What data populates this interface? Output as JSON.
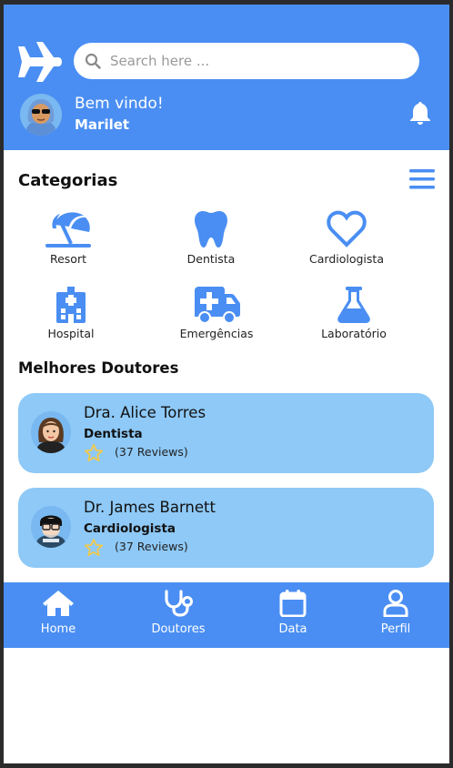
{
  "search": {
    "placeholder": "Search here ..."
  },
  "user": {
    "greeting": "Bem vindo!",
    "name": "Marilet"
  },
  "categories": {
    "title": "Categorias",
    "items": [
      {
        "label": "Resort",
        "icon": "umbrella-beach-icon"
      },
      {
        "label": "Dentista",
        "icon": "tooth-icon"
      },
      {
        "label": "Cardiologista",
        "icon": "heart-icon"
      },
      {
        "label": "Hospital",
        "icon": "hospital-icon"
      },
      {
        "label": "Emergências",
        "icon": "ambulance-icon"
      },
      {
        "label": "Laboratório",
        "icon": "flask-icon"
      }
    ]
  },
  "doctors": {
    "title": "Melhores Doutores",
    "items": [
      {
        "name": "Dra. Alice Torres",
        "specialty": "Dentista",
        "reviews": "(37 Reviews)"
      },
      {
        "name": "Dr. James Barnett",
        "specialty": "Cardiologista",
        "reviews": "(37 Reviews)"
      }
    ]
  },
  "nav": {
    "items": [
      {
        "label": "Home",
        "icon": "home-icon"
      },
      {
        "label": "Doutores",
        "icon": "stethoscope-icon"
      },
      {
        "label": "Data",
        "icon": "calendar-icon"
      },
      {
        "label": "Perfil",
        "icon": "user-icon"
      }
    ]
  },
  "colors": {
    "primary": "#4a8ef3",
    "card": "#8ec9f7",
    "star": "#f2c94c"
  }
}
